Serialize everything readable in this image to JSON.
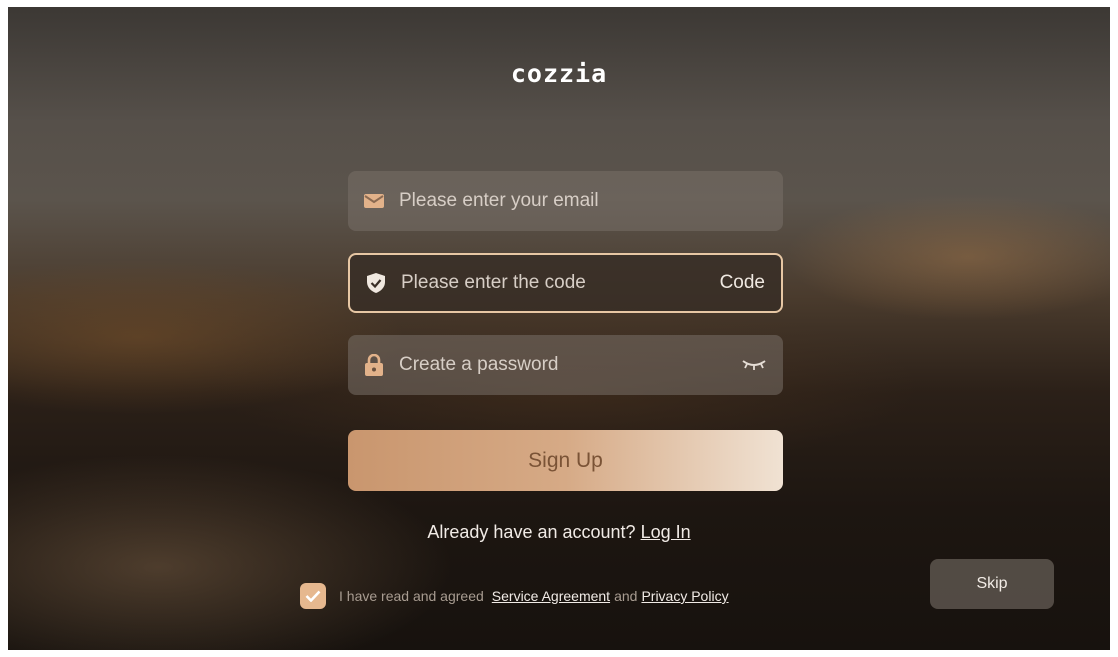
{
  "brand": {
    "logo_text": "cozzia",
    "accent_color": "#e0323a"
  },
  "form": {
    "email": {
      "placeholder": "Please enter your email",
      "icon": "mail-icon"
    },
    "code": {
      "placeholder": "Please enter the code",
      "icon": "shield-check-icon",
      "action_label": "Code"
    },
    "password": {
      "placeholder": "Create a password",
      "icon": "lock-icon",
      "toggle_icon": "eye-closed-icon"
    },
    "submit_label": "Sign Up"
  },
  "login_prompt": {
    "text": "Already have an account?",
    "link": "Log In"
  },
  "agreement": {
    "checked": true,
    "prefix": "I have read and agreed",
    "service_link": "Service Agreement",
    "conjunction": "and",
    "privacy_link": "Privacy Policy"
  },
  "skip_label": "Skip",
  "colors": {
    "button_gradient_start": "#c9966e",
    "button_gradient_end": "#f0e2d3",
    "active_border": "#e7c7a4",
    "checkbox": "#e6b88f"
  }
}
